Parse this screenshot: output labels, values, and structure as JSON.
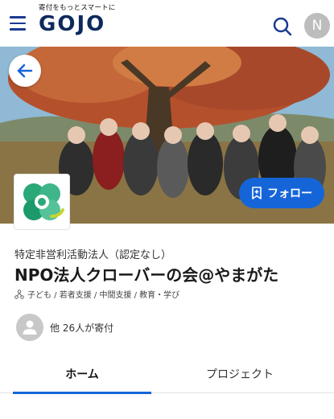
{
  "header": {
    "tagline": "寄付をもっとスマートに",
    "logo": "GOJO",
    "user_initial": "N"
  },
  "cover": {
    "follow_label": "フォロー"
  },
  "org": {
    "type": "特定非営利活動法人（認定なし）",
    "name": "NPO法人クローバーの会@やまがた",
    "categories": "子ども / 若者支援 / 中間支援 / 教育・学び",
    "donors": "他 26人が寄付"
  },
  "tabs": [
    {
      "label": "ホーム",
      "active": true
    },
    {
      "label": "プロジェクト",
      "active": false
    }
  ],
  "colors": {
    "accent": "#1565d8",
    "brand": "#0d2a5c"
  }
}
